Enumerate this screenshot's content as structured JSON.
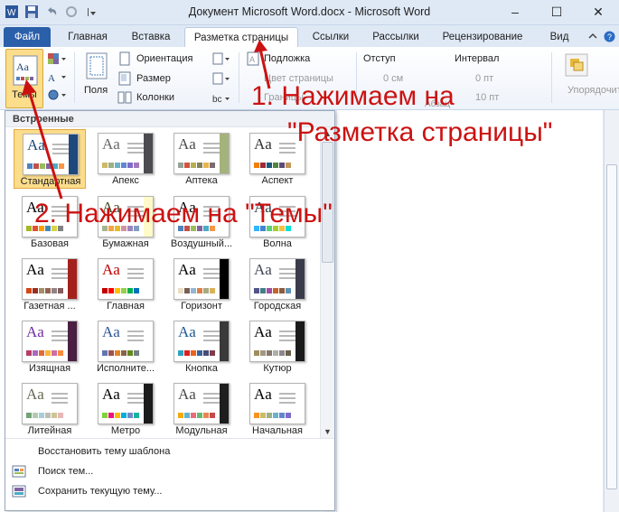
{
  "window": {
    "title": "Документ Microsoft Word.docx  -  Microsoft Word",
    "minimize": "–",
    "maximize": "☐",
    "close": "✕"
  },
  "tabs": [
    "Файл",
    "Главная",
    "Вставка",
    "Разметка страницы",
    "Ссылки",
    "Рассылки",
    "Рецензирование",
    "Вид"
  ],
  "active_tab": "Разметка страницы",
  "ribbon": {
    "themes_label": "Темы",
    "fields_label": "Поля",
    "orientation": "Ориентация",
    "size": "Размер",
    "columns": "Колонки",
    "watermark": "Подложка",
    "page_color": "Цвет страницы",
    "page_borders": "Границы",
    "indent_label": "Отступ",
    "indent_left": "0 см",
    "spacing_label": "Интервал",
    "spacing_before": "0 пт",
    "spacing_after": "10 пт",
    "paragraph_group": "Абзац",
    "arrange": "Упорядочить"
  },
  "gallery": {
    "header": "Встроенные",
    "themes": [
      {
        "name": "Стандартная",
        "aa_color": "#1f497d",
        "swatches": [
          "#4f81bd",
          "#c0504d",
          "#9bbb59",
          "#8064a2",
          "#4bacc6",
          "#f79646"
        ],
        "side": "#1f497d"
      },
      {
        "name": "Апекс",
        "aa_color": "#69676d",
        "swatches": [
          "#ceb966",
          "#9cb084",
          "#6bb1c9",
          "#6585cf",
          "#7e6bc9",
          "#a379bb"
        ],
        "side": "#4c4b50"
      },
      {
        "name": "Аптека",
        "aa_color": "#4b4b4b",
        "swatches": [
          "#93a299",
          "#cf543f",
          "#b5ae53",
          "#848058",
          "#e8b54d",
          "#786c71"
        ],
        "side": "#a4b27b"
      },
      {
        "name": "Аспект",
        "aa_color": "#323232",
        "swatches": [
          "#f07f09",
          "#9f2936",
          "#1b587c",
          "#4e8542",
          "#604878",
          "#c19859"
        ],
        "side": "#ffffff"
      },
      {
        "name": "Базовая",
        "aa_color": "#000000",
        "swatches": [
          "#a6b727",
          "#df5327",
          "#fe9e00",
          "#418ab3",
          "#d7d447",
          "#818183"
        ],
        "side": "#ffffff"
      },
      {
        "name": "Бумажная",
        "aa_color": "#444d26",
        "swatches": [
          "#a5b592",
          "#f3a447",
          "#e7bc29",
          "#d092a7",
          "#9c85c0",
          "#809ec2"
        ],
        "side": "#fefac9"
      },
      {
        "name": "Воздушный...",
        "aa_color": "#000000",
        "swatches": [
          "#4f81bd",
          "#c0504d",
          "#9bbb59",
          "#8064a2",
          "#4bacc6",
          "#f79646"
        ],
        "side": "#ffffff"
      },
      {
        "name": "Волна",
        "aa_color": "#2c3c43",
        "swatches": [
          "#31b6fd",
          "#4584d3",
          "#5bd078",
          "#a5d028",
          "#f5c040",
          "#05e0db"
        ],
        "side": "#ffffff"
      },
      {
        "name": "Газетная ...",
        "aa_color": "#000000",
        "swatches": [
          "#d34817",
          "#9b2d1f",
          "#a28e6a",
          "#956251",
          "#918485",
          "#855d5d"
        ],
        "side": "#a2211c"
      },
      {
        "name": "Главная",
        "aa_color": "#c00000",
        "swatches": [
          "#c00000",
          "#ff0000",
          "#ffc000",
          "#92d050",
          "#00b050",
          "#0070c0"
        ],
        "side": "#ffffff"
      },
      {
        "name": "Горизонт",
        "aa_color": "#000000",
        "swatches": [
          "#ebddc3",
          "#775f55",
          "#94b6d2",
          "#dd8047",
          "#a5ab81",
          "#d8b25c"
        ],
        "side": "#000000"
      },
      {
        "name": "Городская",
        "aa_color": "#424456",
        "swatches": [
          "#53548a",
          "#438086",
          "#a04da3",
          "#c4652d",
          "#8b5d3d",
          "#5c92b5"
        ],
        "side": "#3a3c4c"
      },
      {
        "name": "Изящная",
        "aa_color": "#7030a0",
        "swatches": [
          "#b83d68",
          "#ac66bb",
          "#de6c36",
          "#f9b639",
          "#cf6da4",
          "#fa8d3d"
        ],
        "side": "#4a1f43"
      },
      {
        "name": "Исполните...",
        "aa_color": "#2f5897",
        "swatches": [
          "#6076b4",
          "#9c5252",
          "#e68422",
          "#846648",
          "#63891f",
          "#758085"
        ],
        "side": "#ffffff"
      },
      {
        "name": "Кнопка",
        "aa_color": "#1e5b94",
        "swatches": [
          "#2da2bf",
          "#da1f28",
          "#eb641b",
          "#39639d",
          "#474b78",
          "#7d3c4a"
        ],
        "side": "#3a3a3a"
      },
      {
        "name": "Кутюр",
        "aa_color": "#000000",
        "swatches": [
          "#9e8e5c",
          "#a09781",
          "#85776d",
          "#aeafa9",
          "#8d878b",
          "#6b6149"
        ],
        "side": "#1a1a1a"
      },
      {
        "name": "Литейная",
        "aa_color": "#676a55",
        "swatches": [
          "#72a376",
          "#b0ccb0",
          "#a8cdd7",
          "#c0beaf",
          "#cec597",
          "#e8b7b7"
        ],
        "side": "#ffffff"
      },
      {
        "name": "Метро",
        "aa_color": "#000000",
        "swatches": [
          "#7fd13b",
          "#ea157a",
          "#feb80a",
          "#00addc",
          "#738ac8",
          "#1ab39f"
        ],
        "side": "#1b1b1b"
      },
      {
        "name": "Модульная",
        "aa_color": "#4a4a4a",
        "swatches": [
          "#f0ad00",
          "#60b5cc",
          "#e66c7d",
          "#6bb76d",
          "#e88651",
          "#c64847"
        ],
        "side": "#1e1e1e"
      },
      {
        "name": "Начальная",
        "aa_color": "#000000",
        "swatches": [
          "#f8931d",
          "#ceb966",
          "#9cb084",
          "#6bb1c9",
          "#6585cf",
          "#7e6bc9"
        ],
        "side": "#ffffff"
      }
    ]
  },
  "footer_menu": [
    "Восстановить тему шаблона",
    "Поиск тем...",
    "Сохранить текущую тему..."
  ],
  "annotations": {
    "step1_line1": "1. Нажимаем на",
    "step1_line2": "\"Разметка страницы\"",
    "step2": "2. Нажимаем на \"Темы\"",
    "color": "#cc1111"
  }
}
